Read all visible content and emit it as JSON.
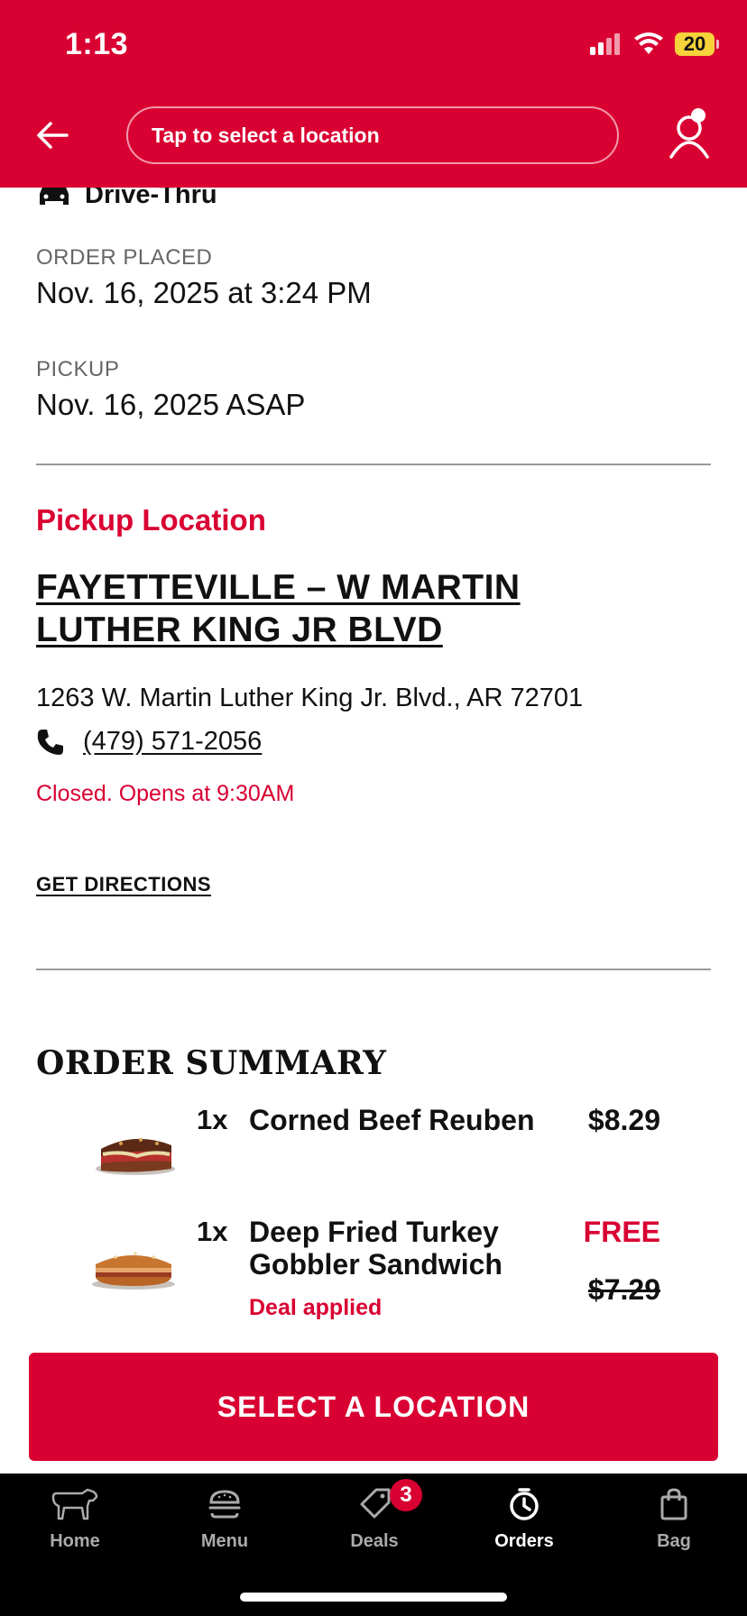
{
  "status_bar": {
    "time": "1:13",
    "battery": "20"
  },
  "header": {
    "location_placeholder": "Tap to select a location"
  },
  "order": {
    "method": "Drive-Thru",
    "placed_label": "ORDER PLACED",
    "placed_value": "Nov. 16, 2025 at 3:24 PM",
    "pickup_label": "PICKUP",
    "pickup_value": "Nov. 16, 2025 ASAP"
  },
  "location": {
    "section_title": "Pickup Location",
    "store_name": "FAYETTEVILLE – W MARTIN LUTHER KING JR BLVD",
    "address": "1263 W. Martin Luther King Jr. Blvd., AR 72701",
    "phone": "(479) 571-2056",
    "hours_status": "Closed. Opens at 9:30AM",
    "directions_label": "GET DIRECTIONS"
  },
  "summary": {
    "title": "ORDER SUMMARY",
    "items": [
      {
        "qty": "1x",
        "name": "Corned Beef Reuben",
        "price": "$8.29"
      },
      {
        "qty": "1x",
        "name": "Deep Fried Turkey Gobbler Sandwich",
        "price": "FREE",
        "original_price": "$7.29",
        "note": "Deal applied"
      }
    ]
  },
  "cta": {
    "label": "SELECT A LOCATION"
  },
  "tabbar": {
    "items": [
      {
        "label": "Home"
      },
      {
        "label": "Menu"
      },
      {
        "label": "Deals",
        "badge": "3"
      },
      {
        "label": "Orders"
      },
      {
        "label": "Bag"
      }
    ]
  },
  "colors": {
    "brand_red": "#d90032",
    "tabbar_bg": "#000000"
  }
}
